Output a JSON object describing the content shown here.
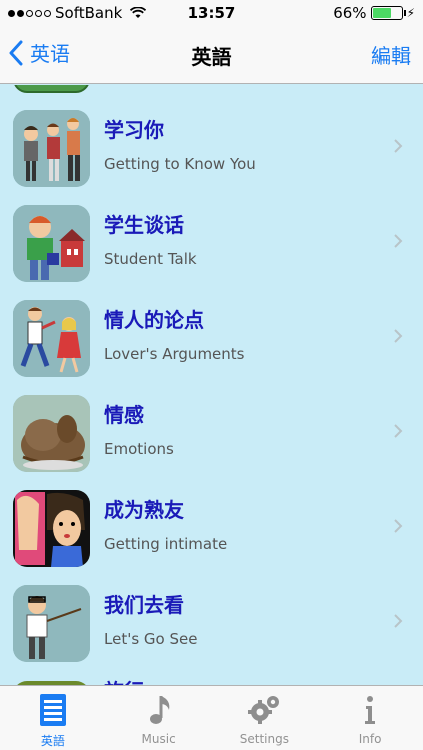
{
  "status": {
    "carrier": "SoftBank",
    "time": "13:57",
    "battery": "66%",
    "battery_level": 0.66,
    "signal_bars": 2
  },
  "nav": {
    "back_label": "英语",
    "title": "英語",
    "edit_label": "編輯"
  },
  "items": [
    {
      "title": "学习你",
      "subtitle": "Getting to Know You"
    },
    {
      "title": "学生谈话",
      "subtitle": "Student Talk"
    },
    {
      "title": "情人的论点",
      "subtitle": "Lover's Arguments"
    },
    {
      "title": "情感",
      "subtitle": "Emotions"
    },
    {
      "title": "成为熟友",
      "subtitle": "Getting intimate"
    },
    {
      "title": "我们去看",
      "subtitle": "Let's Go See"
    }
  ],
  "peek_title": "旅行",
  "tabs": [
    {
      "label": "英語",
      "icon": "document-list-icon",
      "active": true
    },
    {
      "label": "Music",
      "icon": "music-note-icon",
      "active": false
    },
    {
      "label": "Settings",
      "icon": "gears-icon",
      "active": false
    },
    {
      "label": "Info",
      "icon": "info-icon",
      "active": false
    }
  ],
  "colors": {
    "accent": "#1a7cf2",
    "list_bg": "#c9ecf7",
    "title_text": "#1a1ab8"
  }
}
